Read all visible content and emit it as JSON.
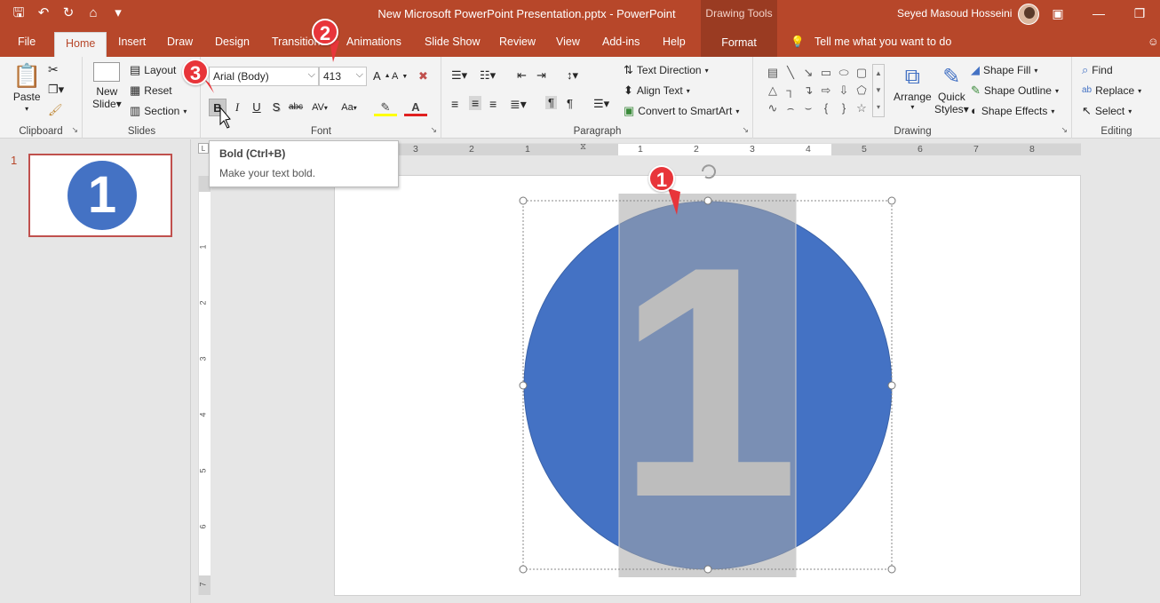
{
  "titlebar": {
    "document_title": "New Microsoft PowerPoint Presentation.pptx  -  PowerPoint",
    "contextual_tab_group": "Drawing Tools",
    "user_name": "Seyed Masoud Hosseini",
    "qat_icons": [
      "save-icon",
      "undo-icon",
      "redo-icon",
      "start-from-beginning-icon",
      "customize-icon"
    ]
  },
  "tabs": {
    "file": "File",
    "home": "Home",
    "insert": "Insert",
    "draw": "Draw",
    "design": "Design",
    "transitions": "Transitions",
    "animations": "Animations",
    "slide_show": "Slide Show",
    "review": "Review",
    "view": "View",
    "addins": "Add-ins",
    "help": "Help",
    "format": "Format",
    "tell_me": "Tell me what you want to do"
  },
  "ribbon": {
    "clipboard": {
      "label": "Clipboard",
      "paste": "Paste"
    },
    "slides": {
      "label": "Slides",
      "new_slide_1": "New",
      "new_slide_2": "Slide",
      "layout": "Layout",
      "reset": "Reset",
      "section": "Section"
    },
    "font": {
      "label": "Font",
      "font_name": "Arial (Body)",
      "font_size": "413",
      "bold": "B",
      "italic": "I",
      "underline": "U",
      "shadow": "S",
      "strike": "abc",
      "spacing": "AV",
      "case": "Aa",
      "grow": "A",
      "shrink": "A"
    },
    "paragraph": {
      "label": "Paragraph",
      "text_direction": "Text Direction",
      "align_text": "Align Text",
      "convert_smartart": "Convert to SmartArt"
    },
    "drawing": {
      "label": "Drawing",
      "arrange": "Arrange",
      "quick_styles_1": "Quick",
      "quick_styles_2": "Styles",
      "shape_fill": "Shape Fill",
      "shape_outline": "Shape Outline",
      "shape_effects": "Shape Effects"
    },
    "editing": {
      "label": "Editing",
      "find": "Find",
      "replace": "Replace",
      "select": "Select"
    }
  },
  "tooltip": {
    "title": "Bold (Ctrl+B)",
    "description": "Make your text bold."
  },
  "slide_panel": {
    "slide_number": "1",
    "thumbnail_text": "1"
  },
  "ruler": {
    "horizontal": [
      "3",
      "2",
      "1",
      "1",
      "2",
      "3",
      "4",
      "5",
      "6",
      "7",
      "8"
    ],
    "vertical": [
      "1",
      "2",
      "3",
      "4",
      "5",
      "6",
      "7"
    ]
  },
  "slide": {
    "number_text": "1",
    "circle_color": "#4472c4",
    "selection_color": "#a8a8a8"
  },
  "callouts": [
    "1",
    "2",
    "3"
  ],
  "colors": {
    "accent": "#b7472a",
    "callout": "#e8353a"
  }
}
